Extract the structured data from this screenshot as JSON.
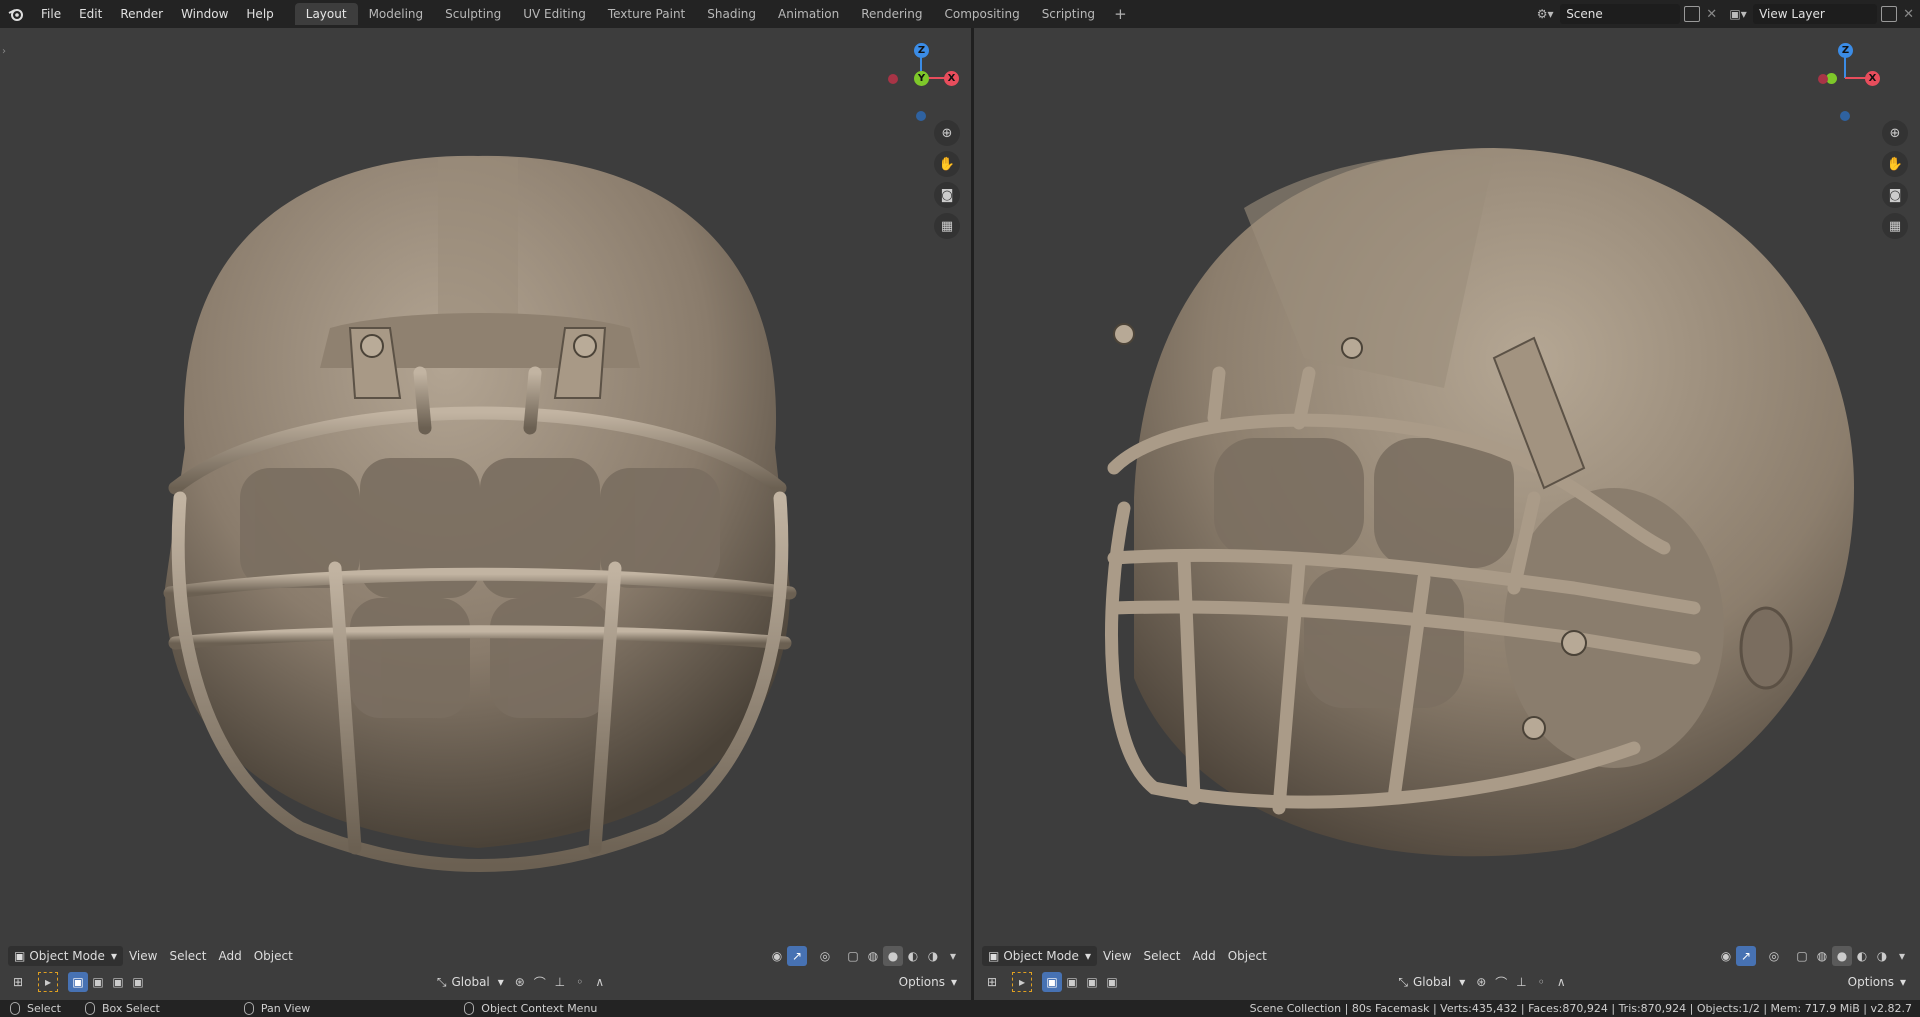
{
  "topbar": {
    "menu": [
      "File",
      "Edit",
      "Render",
      "Window",
      "Help"
    ],
    "tabs": [
      "Layout",
      "Modeling",
      "Sculpting",
      "UV Editing",
      "Texture Paint",
      "Shading",
      "Animation",
      "Rendering",
      "Compositing",
      "Scripting"
    ],
    "active_tab": "Layout",
    "add_tab": "+",
    "scene_name": "Scene",
    "view_layer": "View Layer"
  },
  "viewport_left": {
    "gizmo": {
      "z": "Z",
      "y": "Y",
      "x": "X"
    },
    "header": {
      "mode": "Object Mode",
      "menus": [
        "View",
        "Select",
        "Add",
        "Object"
      ]
    },
    "tool_header": {
      "orientation": "Global",
      "options": "Options"
    }
  },
  "viewport_right": {
    "gizmo": {
      "z": "Z",
      "x": "X"
    },
    "header": {
      "mode": "Object Mode",
      "menus": [
        "View",
        "Select",
        "Add",
        "Object"
      ]
    },
    "tool_header": {
      "orientation": "Global",
      "options": "Options"
    }
  },
  "statusbar": {
    "select": "Select",
    "box_select": "Box Select",
    "pan_view": "Pan View",
    "context_menu": "Object Context Menu",
    "stats": "Scene Collection | 80s Facemask | Verts:435,432 | Faces:870,924 | Tris:870,924 | Objects:1/2 | Mem: 717.9 MiB | v2.82.7"
  },
  "colors": {
    "axis_x": "#e84d5c",
    "axis_y": "#7ec82a",
    "axis_z": "#3b8ce6",
    "helmet": "#8a7c6c",
    "accent": "#4772b3"
  }
}
